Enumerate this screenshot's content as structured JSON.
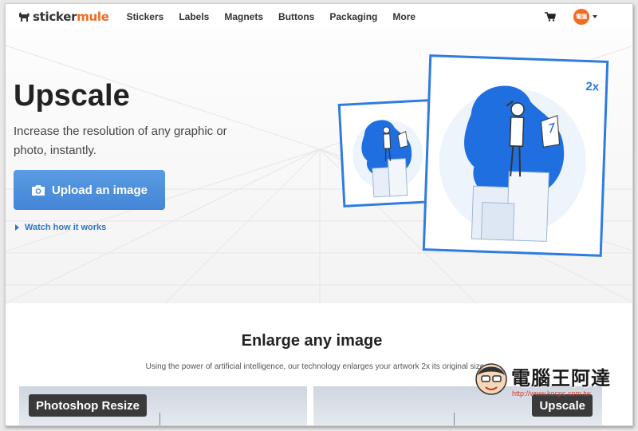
{
  "logo": {
    "part1": "sticker",
    "part2": "mule"
  },
  "nav": {
    "items": [
      "Stickers",
      "Labels",
      "Magnets",
      "Buttons",
      "Packaging",
      "More"
    ]
  },
  "user": {
    "avatar_text": "電腦"
  },
  "hero": {
    "title": "Upscale",
    "subtitle": "Increase the resolution of any graphic or photo, instantly.",
    "upload_label": "Upload an image",
    "watch_label": "Watch how it works",
    "badge": "2x"
  },
  "section": {
    "title": "Enlarge any image",
    "description": "Using the power of artificial intelligence, our technology enlarges your artwork 2x its original size",
    "left_tag": "Photoshop Resize",
    "right_tag": "Upscale"
  },
  "watermark": {
    "text": "電腦王阿達",
    "url": "http://www.kocpc.com.tw"
  },
  "colors": {
    "accent": "#2f7ce0",
    "brand": "#f36b21",
    "button": "#4a90e2"
  },
  "icons": {
    "logo": "mule-icon",
    "cart": "cart-icon",
    "upload": "camera-icon",
    "watch": "play-triangle-icon"
  }
}
